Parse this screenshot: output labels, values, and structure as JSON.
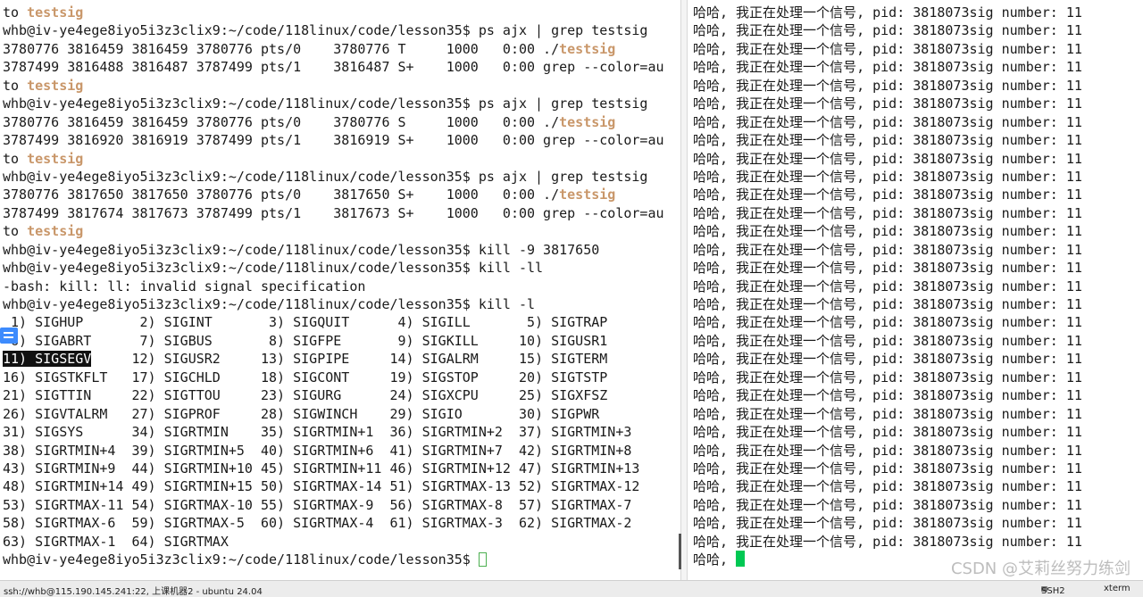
{
  "left_terminal": {
    "lines": [
      "to testsig",
      "whb@iv-ye4ege8iyo5i3z3clix9:~/code/118linux/code/lesson35$ ps ajx | grep testsig",
      "3780776 3816459 3816459 3780776 pts/0    3780776 T     1000   0:00 ./testsig",
      "3787499 3816488 3816487 3787499 pts/1    3816487 S+    1000   0:00 grep --color=au",
      "to testsig",
      "whb@iv-ye4ege8iyo5i3z3clix9:~/code/118linux/code/lesson35$ ps ajx | grep testsig",
      "3780776 3816459 3816459 3780776 pts/0    3780776 S     1000   0:00 ./testsig",
      "3787499 3816920 3816919 3787499 pts/1    3816919 S+    1000   0:00 grep --color=au",
      "to testsig",
      "whb@iv-ye4ege8iyo5i3z3clix9:~/code/118linux/code/lesson35$ ps ajx | grep testsig",
      "3780776 3817650 3817650 3780776 pts/0    3817650 S+    1000   0:00 ./testsig",
      "3787499 3817674 3817673 3787499 pts/1    3817673 S+    1000   0:00 grep --color=au",
      "to testsig",
      "whb@iv-ye4ege8iyo5i3z3clix9:~/code/118linux/code/lesson35$ kill -9 3817650",
      "whb@iv-ye4ege8iyo5i3z3clix9:~/code/118linux/code/lesson35$ kill -ll",
      "-bash: kill: ll: invalid signal specification",
      "whb@iv-ye4ege8iyo5i3z3clix9:~/code/118linux/code/lesson35$ kill -l",
      " 1) SIGHUP       2) SIGINT       3) SIGQUIT      4) SIGILL       5) SIGTRAP",
      " 6) SIGABRT      7) SIGBUS       8) SIGFPE       9) SIGKILL     10) SIGUSR1",
      "11) SIGSEGV     12) SIGUSR2     13) SIGPIPE     14) SIGALRM     15) SIGTERM",
      "16) SIGSTKFLT   17) SIGCHLD     18) SIGCONT     19) SIGSTOP     20) SIGTSTP",
      "21) SIGTTIN     22) SIGTTOU     23) SIGURG      24) SIGXCPU     25) SIGXFSZ",
      "26) SIGVTALRM   27) SIGPROF     28) SIGWINCH    29) SIGIO       30) SIGPWR",
      "31) SIGSYS      34) SIGRTMIN    35) SIGRTMIN+1  36) SIGRTMIN+2  37) SIGRTMIN+3",
      "38) SIGRTMIN+4  39) SIGRTMIN+5  40) SIGRTMIN+6  41) SIGRTMIN+7  42) SIGRTMIN+8",
      "43) SIGRTMIN+9  44) SIGRTMIN+10 45) SIGRTMIN+11 46) SIGRTMIN+12 47) SIGRTMIN+13",
      "48) SIGRTMIN+14 49) SIGRTMIN+15 50) SIGRTMAX-14 51) SIGRTMAX-13 52) SIGRTMAX-12",
      "53) SIGRTMAX-11 54) SIGRTMAX-10 55) SIGRTMAX-9  56) SIGRTMAX-8  57) SIGRTMAX-7",
      "58) SIGRTMAX-6  59) SIGRTMAX-5  60) SIGRTMAX-4  61) SIGRTMAX-3  62) SIGRTMAX-2",
      "63) SIGRTMAX-1  64) SIGRTMAX"
    ],
    "highlight_word": "testsig",
    "selected_text": "11) SIGSEGV",
    "prompt": "whb@iv-ye4ege8iyo5i3z3clix9:~/code/118linux/code/lesson35$ "
  },
  "right_terminal": {
    "lines": [
      "哈哈, 我正在处理一个信号, pid: 3818073sig number: 11",
      "哈哈, 我正在处理一个信号, pid: 3818073sig number: 11",
      "哈哈, 我正在处理一个信号, pid: 3818073sig number: 11",
      "哈哈, 我正在处理一个信号, pid: 3818073sig number: 11",
      "哈哈, 我正在处理一个信号, pid: 3818073sig number: 11",
      "哈哈, 我正在处理一个信号, pid: 3818073sig number: 11",
      "哈哈, 我正在处理一个信号, pid: 3818073sig number: 11",
      "哈哈, 我正在处理一个信号, pid: 3818073sig number: 11",
      "哈哈, 我正在处理一个信号, pid: 3818073sig number: 11",
      "哈哈, 我正在处理一个信号, pid: 3818073sig number: 11",
      "哈哈, 我正在处理一个信号, pid: 3818073sig number: 11",
      "哈哈, 我正在处理一个信号, pid: 3818073sig number: 11",
      "哈哈, 我正在处理一个信号, pid: 3818073sig number: 11",
      "哈哈, 我正在处理一个信号, pid: 3818073sig number: 11",
      "哈哈, 我正在处理一个信号, pid: 3818073sig number: 11",
      "哈哈, 我正在处理一个信号, pid: 3818073sig number: 11",
      "哈哈, 我正在处理一个信号, pid: 3818073sig number: 11",
      "哈哈, 我正在处理一个信号, pid: 3818073sig number: 11",
      "哈哈, 我正在处理一个信号, pid: 3818073sig number: 11",
      "哈哈, 我正在处理一个信号, pid: 3818073sig number: 11",
      "哈哈, 我正在处理一个信号, pid: 3818073sig number: 11",
      "哈哈, 我正在处理一个信号, pid: 3818073sig number: 11",
      "哈哈, 我正在处理一个信号, pid: 3818073sig number: 11",
      "哈哈, 我正在处理一个信号, pid: 3818073sig number: 11",
      "哈哈, 我正在处理一个信号, pid: 3818073sig number: 11",
      "哈哈, 我正在处理一个信号, pid: 3818073sig number: 11",
      "哈哈, 我正在处理一个信号, pid: 3818073sig number: 11",
      "哈哈, 我正在处理一个信号, pid: 3818073sig number: 11",
      "哈哈, 我正在处理一个信号, pid: 3818073sig number: 11",
      "哈哈, 我正在处理一个信号, pid: 3818073sig number: 11"
    ],
    "last_line": "哈哈, "
  },
  "statusbar": {
    "connection": "ssh://whb@115.190.145.241:22, 上课机器2 - ubuntu 24.04",
    "protocol": "SSH2",
    "terminal_type": "xterm"
  },
  "watermark": "CSDN @艾莉丝努力练剑",
  "colors": {
    "highlight": "#c9976a",
    "selection_bg": "#111111",
    "cursor": "#00c853"
  },
  "icons": {
    "float_panel": "list-icon",
    "status_lock": "lock-icon"
  }
}
